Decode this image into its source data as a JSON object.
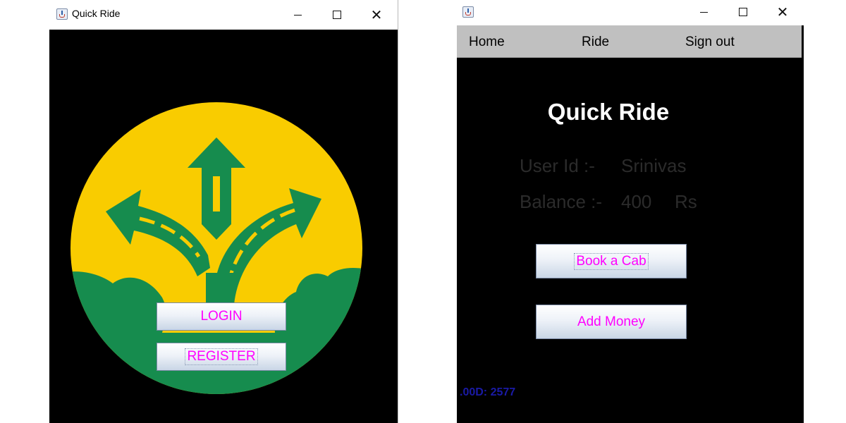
{
  "left_window": {
    "title": "Quick Ride",
    "login_label": "LOGIN",
    "register_label": "REGISTER",
    "colors": {
      "yellow": "#f9cc00",
      "green": "#168c4e",
      "background": "#000000",
      "button_text": "#ff00ff"
    }
  },
  "right_window": {
    "menu": [
      "Home",
      "Ride",
      "Sign out"
    ],
    "title": "Quick Ride",
    "user_id_label": "User Id :-",
    "user_id_value": "Srinivas",
    "balance_label": "Balance :-",
    "balance_value": "400",
    "balance_unit": "Rs",
    "book_cab_label": "Book a Cab",
    "add_money_label": "Add Money",
    "bottom_text": ".00D: 2577"
  },
  "icons": [
    "java-icon",
    "minimize-icon",
    "maximize-icon",
    "close-icon"
  ]
}
